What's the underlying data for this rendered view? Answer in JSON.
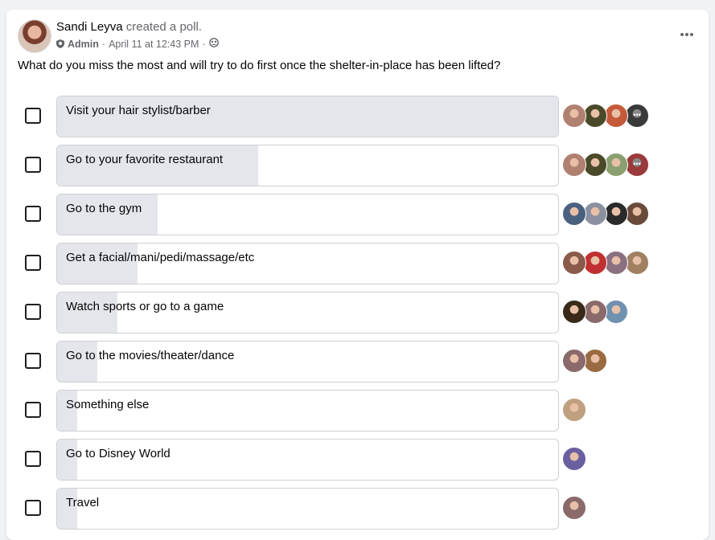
{
  "post": {
    "author": "Sandi Leyva",
    "action": "created a poll.",
    "role": "Admin",
    "timestamp": "April 11 at 12:43 PM",
    "separator": "·",
    "question": "What do you miss the most and will try to do first once the shelter-in-place has been lifted?"
  },
  "poll": {
    "options": [
      {
        "label": "Visit your hair stylist/barber",
        "fill_fraction": 1.0,
        "voters": [
          "#b08070",
          "#4a4a2a",
          "#c45a3a",
          "#3a3a3a"
        ],
        "more": true
      },
      {
        "label": "Go to your favorite restaurant",
        "fill_fraction": 0.4,
        "voters": [
          "#b08070",
          "#4a4a2a",
          "#8aa070",
          "#9a3a3a"
        ],
        "more": true
      },
      {
        "label": "Go to the gym",
        "fill_fraction": 0.2,
        "voters": [
          "#4a6080",
          "#8a90a0",
          "#2a2a2a",
          "#6a4a3a"
        ],
        "more": false
      },
      {
        "label": "Get a facial/mani/pedi/massage/etc",
        "fill_fraction": 0.16,
        "voters": [
          "#8a5a4a",
          "#c03030",
          "#8a7080",
          "#a08060"
        ],
        "more": false
      },
      {
        "label": "Watch sports or go to a game",
        "fill_fraction": 0.12,
        "voters": [
          "#3a2a1a",
          "#8a6a6a",
          "#7090b0"
        ],
        "more": false
      },
      {
        "label": "Go to the movies/theater/dance",
        "fill_fraction": 0.08,
        "voters": [
          "#8a6a6a",
          "#9a6a40"
        ],
        "more": false
      },
      {
        "label": "Something else",
        "fill_fraction": 0.04,
        "voters": [
          "#c0a080"
        ],
        "more": false
      },
      {
        "label": "Go to Disney World",
        "fill_fraction": 0.04,
        "voters": [
          "#6a60a0"
        ],
        "more": false
      },
      {
        "label": "Travel",
        "fill_fraction": 0.04,
        "voters": [
          "#8a6a6a"
        ],
        "more": false
      }
    ]
  },
  "icons": {
    "more": "more-horizontal-icon",
    "privacy": "group-members-icon",
    "admin": "admin-shield-icon"
  },
  "colors": {
    "bar_fill": "#e4e6eb",
    "bar_border": "#ced0d4",
    "secondary_text": "#65676b"
  }
}
